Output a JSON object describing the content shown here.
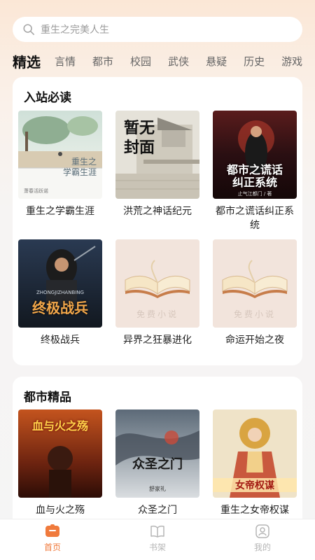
{
  "search": {
    "placeholder": "重生之完美人生",
    "icon": "search-icon"
  },
  "tabs": [
    {
      "label": "精选",
      "active": true
    },
    {
      "label": "言情"
    },
    {
      "label": "都市"
    },
    {
      "label": "校园"
    },
    {
      "label": "武侠"
    },
    {
      "label": "悬疑"
    },
    {
      "label": "历史"
    },
    {
      "label": "游戏"
    }
  ],
  "sections": [
    {
      "title": "入站必读",
      "books": [
        {
          "title": "重生之学霸生涯",
          "cover_text": "重生之\n学霸生涯",
          "cover_sub": "萧春活跃诺"
        },
        {
          "title": "洪荒之神话纪元",
          "cover_text": "暂无\n封面"
        },
        {
          "title": "都市之谎话纠正系统",
          "cover_text": "都市之谎话\n纠正系统",
          "cover_sub": "止气江都门 / 著"
        },
        {
          "title": "终极战兵",
          "cover_text": "终极战兵",
          "cover_sub": "ZHONGJIZHANBING"
        },
        {
          "title": "异界之狂暴进化",
          "cover_text": "免费小说"
        },
        {
          "title": "命运开始之夜",
          "cover_text": "免费小说"
        }
      ]
    },
    {
      "title": "都市精品",
      "books": [
        {
          "title": "血与火之殇",
          "cover_text": "血与火之殇"
        },
        {
          "title": "众圣之门",
          "cover_text": "众圣之门",
          "cover_sub": "舒家礼"
        },
        {
          "title": "重生之女帝权谋",
          "cover_text": "女帝权谋"
        }
      ]
    }
  ],
  "bottom_nav": [
    {
      "label": "首页",
      "icon": "home-icon",
      "active": true
    },
    {
      "label": "书架",
      "icon": "bookshelf-icon"
    },
    {
      "label": "我的",
      "icon": "profile-icon"
    }
  ],
  "colors": {
    "accent": "#f07a3c",
    "background": "#f5f5f5"
  }
}
